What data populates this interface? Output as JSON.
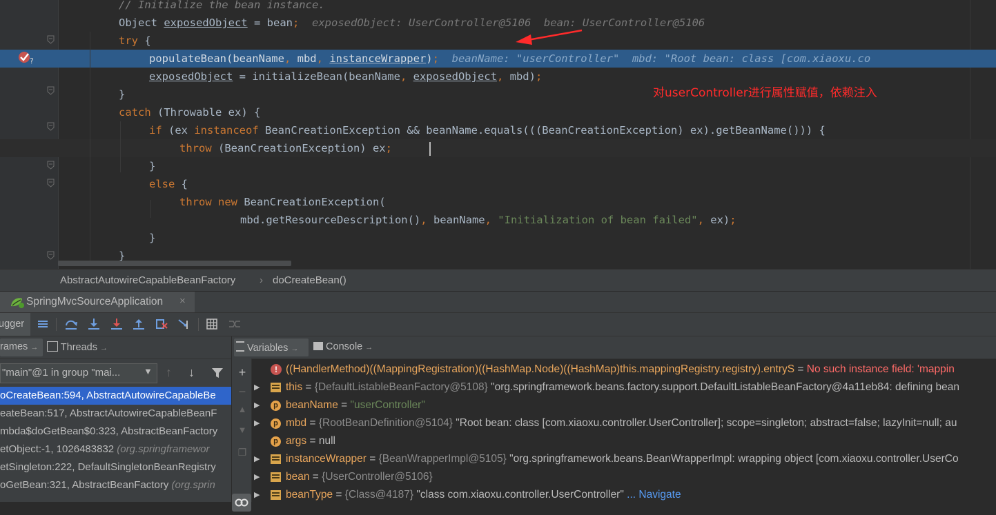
{
  "editor": {
    "lines": [
      {
        "indent": 172,
        "tokens": [
          {
            "t": "// Initialize the bean instance.",
            "c": "cm"
          }
        ]
      },
      {
        "indent": 172,
        "tokens": [
          {
            "t": "Object "
          },
          {
            "t": "exposedObject",
            "c": "u"
          },
          {
            "t": " = bean"
          },
          {
            "t": ";",
            "c": "kw"
          },
          {
            "t": "  exposedObject: UserController@5106  bean: UserController@5106",
            "c": "hint"
          }
        ]
      },
      {
        "indent": 172,
        "tokens": [
          {
            "t": "try",
            "c": "kw"
          },
          {
            "t": " {"
          }
        ]
      },
      {
        "indent": 216,
        "sel": true,
        "tokens": [
          {
            "t": "populateBean(beanName",
            "c": "selt"
          },
          {
            "t": ", ",
            "c": "kw"
          },
          {
            "t": "mbd",
            "c": "selt"
          },
          {
            "t": ", ",
            "c": "kw"
          },
          {
            "t": "instanceWrapper",
            "c": "u selt"
          },
          {
            "t": ")",
            "c": "selt"
          },
          {
            "t": ";",
            "c": "kw"
          },
          {
            "t": "  beanName: \"userController\"  mbd: \"Root bean: class [com.xiaoxu.co",
            "c": "hint-sel"
          }
        ]
      },
      {
        "indent": 216,
        "tokens": [
          {
            "t": "exposedObject",
            "c": "u"
          },
          {
            "t": " = initializeBean(beanName"
          },
          {
            "t": ", ",
            "c": "kw"
          },
          {
            "t": "exposedObject",
            "c": "u"
          },
          {
            "t": ", ",
            "c": "kw"
          },
          {
            "t": "mbd)"
          },
          {
            "t": ";",
            "c": "kw"
          }
        ]
      },
      {
        "indent": 172,
        "tokens": [
          {
            "t": "}"
          }
        ]
      },
      {
        "indent": 172,
        "tokens": [
          {
            "t": "catch",
            "c": "kw"
          },
          {
            "t": " (Throwable ex) {"
          }
        ]
      },
      {
        "indent": 216,
        "tokens": [
          {
            "t": "if",
            "c": "kw"
          },
          {
            "t": " (ex "
          },
          {
            "t": "instanceof",
            "c": "kw"
          },
          {
            "t": " BeanCreationException && beanName.equals(((BeanCreationException) ex).getBeanName())) {"
          }
        ]
      },
      {
        "indent": 260,
        "cur": true,
        "tokens": [
          {
            "t": "throw",
            "c": "kw"
          },
          {
            "t": " (BeanCreationException) ex"
          },
          {
            "t": ";",
            "c": "kw"
          }
        ]
      },
      {
        "indent": 216,
        "tokens": [
          {
            "t": "}"
          }
        ]
      },
      {
        "indent": 216,
        "tokens": [
          {
            "t": "else",
            "c": "kw"
          },
          {
            "t": " {"
          }
        ]
      },
      {
        "indent": 260,
        "tokens": [
          {
            "t": "throw new",
            "c": "kw"
          },
          {
            "t": " BeanCreationException("
          }
        ]
      },
      {
        "indent": 348,
        "tokens": [
          {
            "t": "mbd.getResourceDescription()"
          },
          {
            "t": ", ",
            "c": "kw"
          },
          {
            "t": "beanName"
          },
          {
            "t": ", ",
            "c": "kw"
          },
          {
            "t": "\"Initialization of bean failed\"",
            "c": "str"
          },
          {
            "t": ", ",
            "c": "kw"
          },
          {
            "t": "ex)"
          },
          {
            "t": ";",
            "c": "kw"
          }
        ]
      },
      {
        "indent": 216,
        "tokens": [
          {
            "t": "}"
          }
        ]
      },
      {
        "indent": 172,
        "tokens": [
          {
            "t": "}"
          }
        ]
      }
    ],
    "annotation": "对userController进行属性赋值，依赖注入"
  },
  "breadcrumb": {
    "class_name": "AbstractAutowireCapableBeanFactory",
    "separator": "›",
    "method": "doCreateBean()"
  },
  "run_tab": {
    "label": "SpringMvcSourceApplication",
    "close": "×"
  },
  "debugger": {
    "label": "ugger"
  },
  "left_panel": {
    "tabs": [
      {
        "label": "rames"
      },
      {
        "label": "Threads"
      }
    ],
    "pin": "→",
    "thread_select": "\"main\"@1 in group \"mai...",
    "frames": [
      {
        "text": "oCreateBean:594, AbstractAutowireCapableBe",
        "pkg": "",
        "active": true
      },
      {
        "text": "eateBean:517, AbstractAutowireCapableBeanF",
        "pkg": "",
        "active": false
      },
      {
        "text": "mbda$doGetBean$0:323, AbstractBeanFactory",
        "pkg": "",
        "active": false
      },
      {
        "text": "etObject:-1, 1026483832 ",
        "pkg": "(org.springframewor",
        "active": false
      },
      {
        "text": "etSingleton:222, DefaultSingletonBeanRegistry",
        "pkg": "",
        "active": false
      },
      {
        "text": "oGetBean:321, AbstractBeanFactory ",
        "pkg": "(org.sprin",
        "active": false
      }
    ]
  },
  "right_panel": {
    "tabs": [
      {
        "label": "Variables"
      },
      {
        "label": "Console"
      }
    ],
    "variables": [
      {
        "kind": "error",
        "expand": false,
        "name": "((HandlerMethod)((MappingRegistration)((HashMap.Node)((HashMap)this.mappingRegistry.registry).entryS",
        "eq": " = ",
        "type": "",
        "value": "",
        "err": "No such instance field: 'mappin"
      },
      {
        "kind": "field",
        "expand": true,
        "name": "this",
        "eq": " = ",
        "type": "{DefaultListableBeanFactory@5108} ",
        "value": "\"org.springframework.beans.factory.support.DefaultListableBeanFactory@4a11eb84: defining bean",
        "err": ""
      },
      {
        "kind": "param",
        "expand": true,
        "name": "beanName",
        "eq": " = ",
        "type": "",
        "str": "\"userController\"",
        "value": "",
        "err": ""
      },
      {
        "kind": "param",
        "expand": true,
        "name": "mbd",
        "eq": " = ",
        "type": "{RootBeanDefinition@5104} ",
        "value": "\"Root bean: class [com.xiaoxu.controller.UserController]; scope=singleton; abstract=false; lazyInit=null; au",
        "err": ""
      },
      {
        "kind": "param",
        "expand": false,
        "name": "args",
        "eq": " = ",
        "type": "",
        "value": "null",
        "err": ""
      },
      {
        "kind": "field",
        "expand": true,
        "name": "instanceWrapper",
        "eq": " = ",
        "type": "{BeanWrapperImpl@5105} ",
        "value": "\"org.springframework.beans.BeanWrapperImpl: wrapping object [com.xiaoxu.controller.UserCo",
        "err": ""
      },
      {
        "kind": "field",
        "expand": true,
        "name": "bean",
        "eq": " = ",
        "type": "{UserController@5106}",
        "value": "",
        "err": ""
      },
      {
        "kind": "field",
        "expand": true,
        "name": "beanType",
        "eq": " = ",
        "type": "{Class@4187} ",
        "value": "\"class com.xiaoxu.controller.UserController\"",
        "link": " ... Navigate",
        "err": ""
      }
    ]
  },
  "colors": {
    "accent": "#2f65ca",
    "selection": "#2d5b8a",
    "keyword": "#cc7832",
    "annotation": "#ff2b2b"
  }
}
